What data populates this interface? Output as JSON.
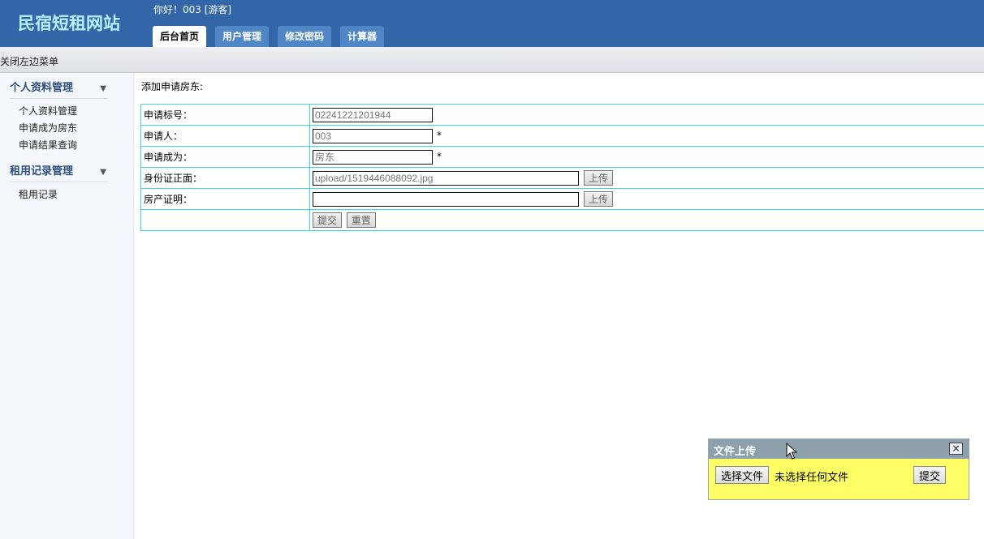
{
  "header": {
    "site_title": "民宿短租网站",
    "greeting": "你好！003 [游客]",
    "tabs": [
      {
        "label": "后台首页",
        "active": true
      },
      {
        "label": "用户管理",
        "active": false
      },
      {
        "label": "修改密码",
        "active": false
      },
      {
        "label": "计算器",
        "active": false
      }
    ]
  },
  "subbar": {
    "toggle_label": "关闭左边菜单"
  },
  "sidebar": {
    "sections": [
      {
        "title": "个人资料管理",
        "items": [
          "个人资料管理",
          "申请成为房东",
          "申请结果查询"
        ]
      },
      {
        "title": "租用记录管理",
        "items": [
          "租用记录"
        ]
      }
    ]
  },
  "main": {
    "title": "添加申请房东:",
    "form": {
      "application_no_label": "申请标号：",
      "application_no_value": "02241221201944",
      "applicant_label": "申请人：",
      "applicant_value": "003",
      "apply_as_label": "申请成为：",
      "apply_as_value": "房东",
      "required_mark": "*",
      "id_front_label": "身份证正面：",
      "id_front_value": "upload/1519446088092.jpg",
      "property_cert_label": "房产证明：",
      "property_cert_value": "",
      "upload_label": "上传",
      "submit_label": "提交",
      "reset_label": "重置"
    }
  },
  "upload_dialog": {
    "title": "文件上传",
    "close_label": "×",
    "choose_file_label": "选择文件",
    "no_file_text": "未选择任何文件",
    "submit_label": "提交"
  }
}
